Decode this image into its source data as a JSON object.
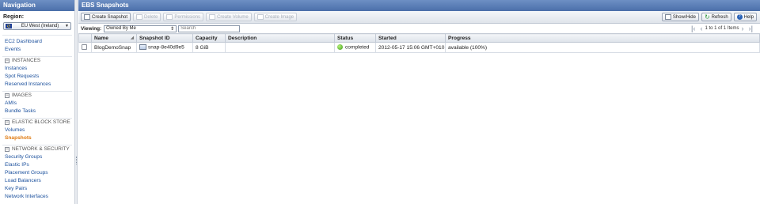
{
  "nav": {
    "title": "Navigation",
    "region_label": "Region:",
    "region_value": "EU West (Ireland)",
    "links_top": [
      "EC2 Dashboard",
      "Events"
    ],
    "sections": [
      {
        "label": "INSTANCES",
        "items": [
          "Instances",
          "Spot Requests",
          "Reserved Instances"
        ]
      },
      {
        "label": "IMAGES",
        "items": [
          "AMIs",
          "Bundle Tasks"
        ]
      },
      {
        "label": "ELASTIC BLOCK STORE",
        "items": [
          "Volumes",
          "Snapshots"
        ],
        "active": "Snapshots"
      },
      {
        "label": "NETWORK & SECURITY",
        "items": [
          "Security Groups",
          "Elastic IPs",
          "Placement Groups",
          "Load Balancers",
          "Key Pairs",
          "Network Interfaces"
        ]
      }
    ]
  },
  "main": {
    "title": "EBS Snapshots",
    "toolbar": {
      "create_snapshot": "Create Snapshot",
      "delete": "Delete",
      "permissions": "Permissions",
      "create_volume": "Create Volume",
      "create_image": "Create Image",
      "show_hide": "Show/Hide",
      "refresh": "Refresh",
      "help": "Help"
    },
    "filter": {
      "viewing_label": "Viewing:",
      "viewing_value": "Owned By Me",
      "search_placeholder": "Search"
    },
    "pager": {
      "text": "1 to 1 of 1 Items"
    },
    "table": {
      "columns": [
        "Name",
        "Snapshot ID",
        "Capacity",
        "Description",
        "Status",
        "Started",
        "Progress"
      ],
      "rows": [
        {
          "name": "BlogDemoSnap",
          "snapshot_id": "snap-8e40d9e5",
          "capacity": "8 GiB",
          "description": "",
          "status": "completed",
          "started": "2012-05-17 15:06 GMT+010",
          "progress": "available (100%)"
        }
      ]
    }
  },
  "colors": {
    "header_blue": "#4b6fa9",
    "link_blue": "#1a4f9c",
    "active_orange": "#e07a10",
    "status_green": "#3a9a1a"
  }
}
